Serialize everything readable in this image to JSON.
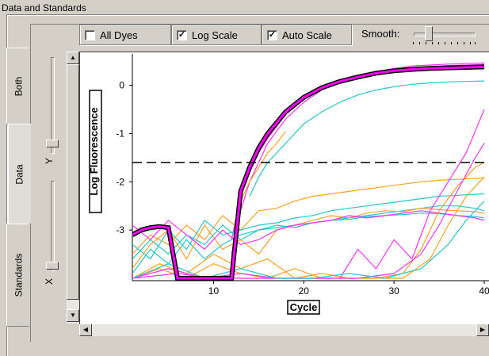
{
  "group": {
    "title": "Data and Standards"
  },
  "options": {
    "all_dyes": {
      "label": "All Dyes",
      "checked": false
    },
    "log_scale": {
      "label": "Log Scale",
      "checked": true
    },
    "auto_scale": {
      "label": "Auto Scale",
      "checked": true
    },
    "smooth_label": "Smooth:",
    "smooth_level": 0.22
  },
  "tabs": [
    {
      "label": "Both"
    },
    {
      "label": "Data"
    },
    {
      "label": "Standards"
    }
  ],
  "zoom": {
    "y_label": "Y",
    "x_label": "X"
  },
  "icons": {
    "scroll_up": "arrow-up-icon",
    "scroll_down": "arrow-down-icon",
    "scroll_left": "arrow-left-icon",
    "scroll_right": "arrow-right-icon",
    "checkmark": "check-icon"
  },
  "colors": {
    "highlight": "#ff00ff",
    "highlight_outline": "#000000",
    "orange": "#ffa020",
    "cyan": "#20c8c8",
    "magenta": "#ff30ff",
    "threshold": "#000000"
  },
  "chart_data": {
    "type": "line",
    "xlabel": "Cycle",
    "ylabel": "Log Fluorescence",
    "xlim": [
      1,
      40
    ],
    "ylim": [
      -4.05,
      0.65
    ],
    "x_ticks": [
      10,
      20,
      30,
      40
    ],
    "x_tick_labels": [
      "10",
      "20",
      "30",
      "40"
    ],
    "y_ticks": [
      0,
      -1,
      -2,
      -3
    ],
    "y_tick_labels": [
      "0",
      "-1",
      "-2",
      "-3"
    ],
    "threshold": -1.6,
    "series": [
      {
        "color": "#ff00ff",
        "highlight": true,
        "x": [
          1,
          2,
          3,
          4,
          5,
          6,
          7,
          8,
          9,
          10,
          11,
          12,
          13,
          14,
          15,
          16,
          18,
          20,
          22,
          24,
          26,
          28,
          30,
          32,
          34,
          36,
          38,
          40
        ],
        "y": [
          -3.1,
          -3.0,
          -2.95,
          -2.93,
          -2.95,
          -4.0,
          -4.0,
          -4.0,
          -4.0,
          -4.0,
          -4.0,
          -4.0,
          -2.2,
          -1.7,
          -1.3,
          -1.0,
          -0.55,
          -0.25,
          -0.05,
          0.08,
          0.17,
          0.25,
          0.3,
          0.33,
          0.35,
          0.36,
          0.37,
          0.38
        ]
      },
      {
        "color": "#ff30ff",
        "x": [
          12,
          13,
          14,
          15,
          16,
          18,
          20,
          22,
          24,
          26,
          28,
          30,
          32,
          34,
          36,
          38,
          40
        ],
        "y": [
          -3.5,
          -2.6,
          -2.0,
          -1.6,
          -1.2,
          -0.7,
          -0.35,
          -0.1,
          0.05,
          0.18,
          0.28,
          0.35,
          0.4,
          0.42,
          0.44,
          0.45,
          0.46
        ]
      },
      {
        "color": "#ff30ff",
        "x": [
          12,
          13,
          14,
          15,
          16,
          18,
          20,
          22,
          24,
          26,
          28,
          30,
          32,
          34,
          36,
          38,
          40
        ],
        "y": [
          -3.2,
          -2.3,
          -1.8,
          -1.4,
          -1.1,
          -0.6,
          -0.3,
          -0.08,
          0.08,
          0.2,
          0.28,
          0.33,
          0.37,
          0.39,
          0.41,
          0.42,
          0.43
        ]
      },
      {
        "color": "#20c8c8",
        "x": [
          14,
          15,
          16,
          18,
          20,
          22,
          24,
          26,
          28,
          30,
          32,
          34,
          36,
          38,
          40
        ],
        "y": [
          -2.3,
          -1.9,
          -1.6,
          -1.2,
          -0.8,
          -0.55,
          -0.35,
          -0.2,
          -0.1,
          -0.03,
          0.02,
          0.05,
          0.07,
          0.08,
          0.09
        ]
      },
      {
        "color": "#ffa020",
        "x": [
          12,
          13,
          14,
          15,
          16,
          17,
          18
        ],
        "y": [
          -3.6,
          -2.4,
          -2.0,
          -1.7,
          -1.4,
          -1.2,
          -0.95
        ]
      },
      {
        "color": "#ffa020",
        "x": [
          1,
          3,
          5,
          7,
          9,
          11,
          13,
          15,
          17,
          19,
          21,
          23,
          25,
          27,
          29,
          31,
          33,
          35,
          37,
          39,
          40
        ],
        "y": [
          -3.5,
          -3.1,
          -3.3,
          -2.9,
          -3.2,
          -2.7,
          -3.0,
          -2.6,
          -2.55,
          -2.4,
          -2.3,
          -2.25,
          -2.2,
          -2.15,
          -2.1,
          -2.05,
          -2.0,
          -1.97,
          -1.95,
          -1.93,
          -1.92
        ]
      },
      {
        "color": "#20c8c8",
        "x": [
          1,
          3,
          5,
          7,
          9,
          11,
          13,
          15,
          17,
          19,
          21,
          23,
          25,
          27,
          29,
          31,
          33,
          35,
          37,
          39,
          40
        ],
        "y": [
          -3.3,
          -3.6,
          -3.0,
          -3.4,
          -2.8,
          -3.1,
          -3.0,
          -2.9,
          -2.85,
          -2.75,
          -2.7,
          -2.6,
          -2.55,
          -2.5,
          -2.45,
          -2.4,
          -2.35,
          -2.3,
          -2.28,
          -2.26,
          -2.25
        ]
      },
      {
        "color": "#20c8c8",
        "x": [
          1,
          3,
          5,
          7,
          9,
          11,
          13,
          15,
          17,
          19,
          21,
          23,
          25,
          27,
          29,
          31,
          33,
          35,
          37,
          39,
          40
        ],
        "y": [
          -3.6,
          -3.2,
          -3.5,
          -3.1,
          -3.3,
          -2.9,
          -3.2,
          -3.0,
          -2.95,
          -2.9,
          -2.85,
          -2.8,
          -2.75,
          -2.7,
          -2.65,
          -2.6,
          -2.55,
          -2.5,
          -2.5,
          -2.55,
          -2.6
        ]
      },
      {
        "color": "#20c8c8",
        "x": [
          1,
          3,
          5,
          7,
          9,
          11,
          13,
          15,
          17,
          19,
          21,
          23,
          25,
          27,
          29,
          31,
          33,
          35,
          37,
          39,
          40
        ],
        "y": [
          -3.9,
          -3.4,
          -3.7,
          -3.2,
          -3.6,
          -3.3,
          -3.1,
          -3.0,
          -2.9,
          -2.95,
          -2.85,
          -2.8,
          -2.78,
          -2.72,
          -2.7,
          -2.68,
          -2.65,
          -2.66,
          -2.7,
          -2.72,
          -2.75
        ]
      },
      {
        "color": "#ffa020",
        "x": [
          1,
          3,
          5,
          7,
          9,
          11,
          13,
          15,
          17,
          19,
          21,
          23,
          25,
          27,
          29,
          31,
          33,
          35,
          37,
          39,
          40
        ],
        "y": [
          -3.8,
          -3.3,
          -3.0,
          -3.6,
          -2.9,
          -3.4,
          -3.2,
          -3.5,
          -3.0,
          -2.9,
          -2.8,
          -2.7,
          -2.75,
          -2.65,
          -2.6,
          -2.62,
          -2.55,
          -2.58,
          -2.6,
          -2.62,
          -2.65
        ]
      },
      {
        "color": "#ff30ff",
        "x": [
          1,
          3,
          5,
          7,
          9,
          11,
          13,
          15,
          17,
          19,
          21,
          23,
          25,
          27,
          29,
          31,
          33,
          35,
          37,
          39,
          40
        ],
        "y": [
          -2.9,
          -3.2,
          -2.8,
          -3.1,
          -3.4,
          -3.0,
          -3.3,
          -3.2,
          -3.0,
          -2.9,
          -2.85,
          -2.8,
          -2.7,
          -2.75,
          -2.7,
          -2.65,
          -2.6,
          -2.65,
          -2.7,
          -2.75,
          -2.8
        ]
      },
      {
        "color": "#ffa020",
        "x": [
          1,
          4,
          7,
          10,
          13,
          16,
          19,
          22,
          25,
          28,
          31,
          34,
          36,
          38,
          40
        ],
        "y": [
          -4.0,
          -3.7,
          -3.9,
          -3.5,
          -3.8,
          -3.6,
          -4.0,
          -3.9,
          -4.0,
          -4.0,
          -4.0,
          -3.6,
          -2.9,
          -2.3,
          -1.9
        ]
      },
      {
        "color": "#ffa020",
        "x": [
          1,
          4,
          7,
          10,
          13,
          16,
          19,
          22,
          25,
          28,
          31,
          33,
          35,
          37,
          39,
          40
        ],
        "y": [
          -4.0,
          -3.8,
          -4.0,
          -3.7,
          -3.9,
          -4.0,
          -3.8,
          -4.0,
          -4.0,
          -4.0,
          -3.9,
          -3.4,
          -2.6,
          -2.1,
          -1.7,
          -1.6
        ]
      },
      {
        "color": "#ff30ff",
        "x": [
          1,
          5,
          9,
          13,
          17,
          21,
          24,
          26,
          28,
          30,
          32,
          34,
          36,
          38,
          40
        ],
        "y": [
          -4.0,
          -3.8,
          -4.0,
          -3.9,
          -4.0,
          -4.0,
          -4.0,
          -3.4,
          -3.8,
          -3.2,
          -3.6,
          -2.6,
          -2.0,
          -1.4,
          -0.5
        ]
      },
      {
        "color": "#ff30ff",
        "x": [
          1,
          6,
          10,
          14,
          18,
          22,
          26,
          30,
          33,
          35,
          37,
          39,
          40
        ],
        "y": [
          -4.0,
          -3.9,
          -4.0,
          -4.0,
          -4.0,
          -4.0,
          -4.0,
          -3.9,
          -3.5,
          -2.9,
          -2.2,
          -1.5,
          -1.2
        ]
      },
      {
        "color": "#20c8c8",
        "x": [
          1,
          5,
          9,
          13,
          17,
          21,
          25,
          29,
          33,
          36,
          38,
          40
        ],
        "y": [
          -4.0,
          -3.7,
          -4.0,
          -3.8,
          -4.0,
          -4.0,
          -3.9,
          -4.0,
          -3.8,
          -3.3,
          -2.8,
          -2.4
        ]
      }
    ]
  }
}
